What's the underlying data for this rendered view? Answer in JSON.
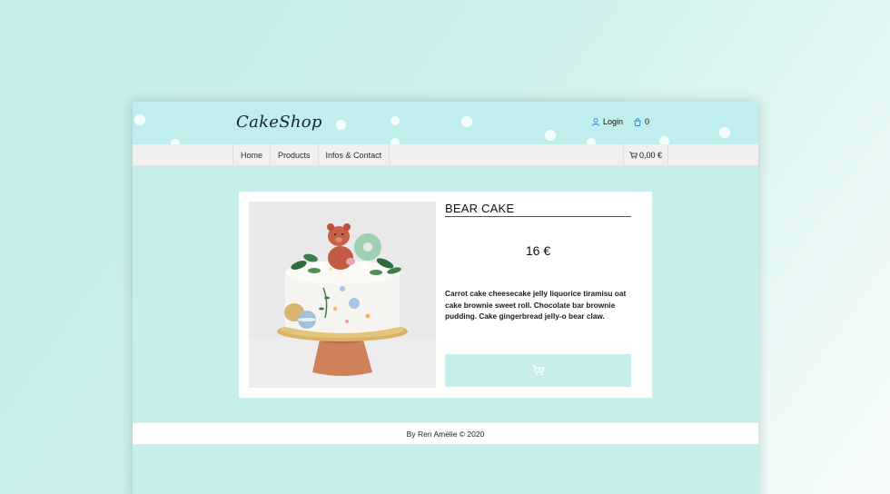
{
  "header": {
    "logo": "CakeShop",
    "login_label": "Login",
    "basket_count": "0"
  },
  "nav": {
    "items": [
      {
        "label": "Home"
      },
      {
        "label": "Products"
      },
      {
        "label": "Infos & Contact"
      }
    ],
    "cart_total": "0,00 €"
  },
  "product": {
    "title": "BEAR CAKE",
    "price": "16 €",
    "description": "Carrot cake cheesecake jelly liquorice tiramisu oat cake brownie sweet roll. Chocolate bar brownie pudding. Cake gingerbread jelly-o bear claw.",
    "image_icon": "bear-cake-photo",
    "cart_button_icon": "cart-plus-icon"
  },
  "footer": {
    "text": "By Ren Amélie © 2020"
  },
  "colors": {
    "header_bg": "#bfeeed",
    "page_bg": "#c6efeb",
    "nav_bg": "#f2eff0",
    "button_bg": "#c6efec",
    "icon_blue": "#3b7fd6"
  }
}
